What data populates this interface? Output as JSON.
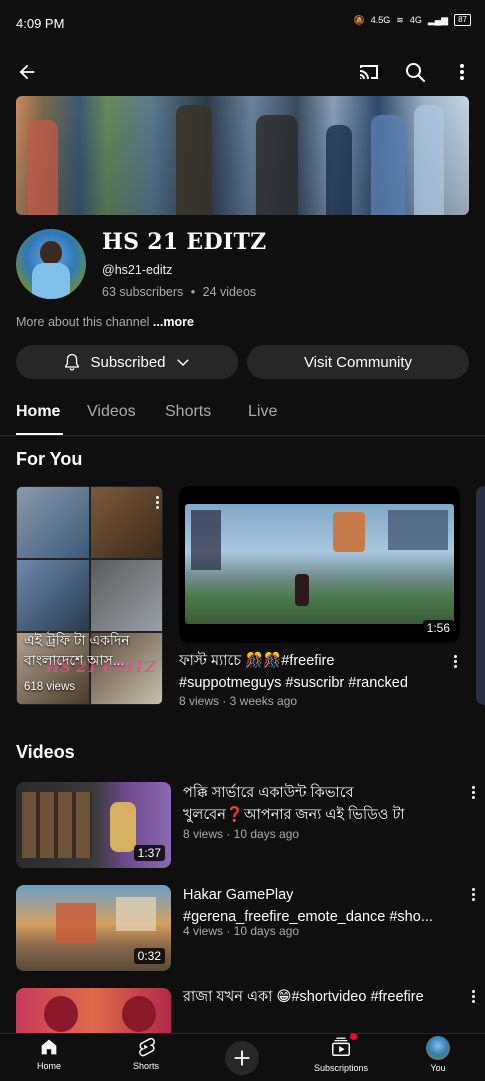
{
  "status_bar": {
    "time": "4:09 PM",
    "signal_text": "4.5G",
    "network_text": "4G",
    "battery": "87"
  },
  "top_bar": {
    "back_icon": "arrow-left-icon",
    "cast_icon": "cast-icon",
    "search_icon": "search-icon",
    "menu_icon": "more-vert-icon"
  },
  "channel": {
    "name": "HS 21 EDITZ",
    "handle": "@hs21-editz",
    "subscribers": "63 subscribers",
    "separator": "•",
    "videos_count": "24 videos",
    "about_prefix": "More about this channel",
    "about_more": "...more"
  },
  "actions": {
    "subscribed_label": "Subscribed",
    "visit_community_label": "Visit Community"
  },
  "tabs": [
    "Home",
    "Videos",
    "Shorts",
    "Live"
  ],
  "for_you": {
    "title": "For You",
    "short": {
      "title": "এই ট্রফি টা একদিন বাংলাদেশে আস...",
      "views": "618 views",
      "watermark": "HS 21 EDITZ"
    },
    "video": {
      "duration": "1:56",
      "title": "ফাস্ট ম্যাচে 🎊🎊#freefire #suppotmeguys #suscribr #rancked",
      "meta": "8 views · 3 weeks ago"
    }
  },
  "videos_section": {
    "title": "Videos",
    "items": [
      {
        "duration": "1:37",
        "title": "পক্কি সার্ভারে একাউন্ট কিভাবে খুলবেন❓আপনার জন্য এই ভিডিও টা",
        "meta": "8 views · 10 days ago"
      },
      {
        "duration": "0:32",
        "title": "Hakar GamePlay #gerena_freefire_emote_dance #sho...",
        "meta": "4 views · 10 days ago"
      },
      {
        "duration": "",
        "title": "রাজা যখন একা 😁#shortvideo #freefire",
        "meta": ""
      }
    ]
  },
  "bottom_nav": [
    {
      "label": "Home",
      "icon": "home-icon"
    },
    {
      "label": "Shorts",
      "icon": "shorts-icon"
    },
    {
      "label": "",
      "icon": "create-plus-icon"
    },
    {
      "label": "Subscriptions",
      "icon": "subscriptions-icon"
    },
    {
      "label": "You",
      "icon": "avatar-icon"
    }
  ],
  "colors": {
    "background": "#0f0f0f",
    "pill": "#272727",
    "secondary_text": "#aaaaaa",
    "notification_dot": "#ff0033"
  }
}
